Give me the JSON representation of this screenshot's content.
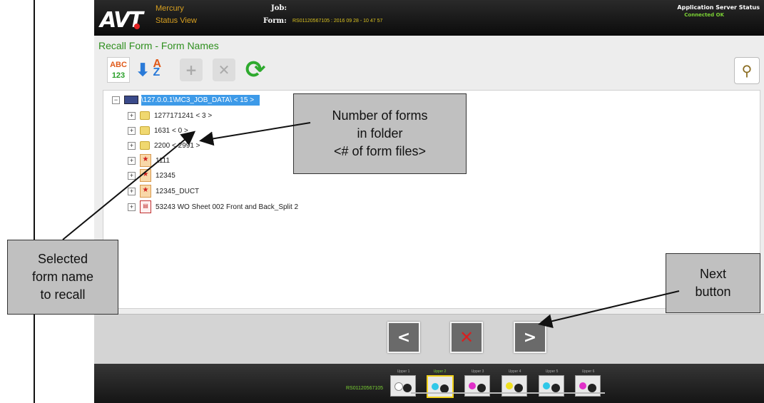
{
  "header": {
    "logo": "AVT",
    "product_line1": "Mercury",
    "product_line2": "Status View",
    "job_label": "Job:",
    "form_label": "Form:",
    "form_value": "RS01120567105 : 2016 09 28 - 10 47 57",
    "server_status_label": "Application Server Status",
    "server_status_value": "Connected OK"
  },
  "page_title": "Recall Form - Form Names",
  "toolbar": {
    "abc_line1": "ABC",
    "abc_line2": "123",
    "sort_a": "A",
    "sort_z": "Z"
  },
  "tree": {
    "root": "\\127.0.0.1\\MC3_JOB_DATA\\ < 15 >",
    "items": [
      {
        "label": "1277171241 < 3 >",
        "icon": "folder-icon"
      },
      {
        "label": "1631 < 0 >",
        "icon": "folder-icon"
      },
      {
        "label": "2200 < 2991 >",
        "icon": "folder-icon"
      },
      {
        "label": "1111",
        "icon": "form-file-icon"
      },
      {
        "label": "12345",
        "icon": "form-file-icon"
      },
      {
        "label": "12345_DUCT",
        "icon": "form-file-icon"
      },
      {
        "label": "53243 WO Sheet 002 Front and Back_Split 2",
        "icon": "pdf-file-icon"
      }
    ]
  },
  "status_bar": {
    "job_id": "RS01120567105",
    "units": [
      {
        "label": "Upper 1",
        "active": false,
        "color": "#ffffff"
      },
      {
        "label": "Upper 2",
        "active": true,
        "color": "#30c8e8"
      },
      {
        "label": "Upper 3",
        "active": false,
        "color": "#e030c8"
      },
      {
        "label": "Upper 4",
        "active": false,
        "color": "#f0e020"
      },
      {
        "label": "Upper 5",
        "active": false,
        "color": "#30c8e8"
      },
      {
        "label": "Upper 6",
        "active": false,
        "color": "#e030c8"
      }
    ]
  },
  "callouts": {
    "forms_count": [
      "Number of forms",
      "in folder",
      "<# of form files>"
    ],
    "selected": [
      "Selected",
      "form name",
      "to recall"
    ],
    "next": [
      "Next",
      "button"
    ]
  },
  "colors": {
    "title_green": "#2f8f1f",
    "selection_blue": "#3d9ae8",
    "status_green": "#7bd234",
    "brand_gold": "#d8a020"
  }
}
